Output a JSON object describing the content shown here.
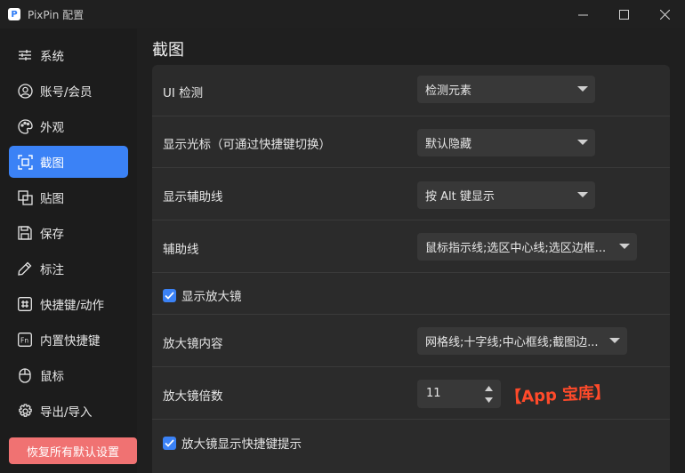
{
  "window": {
    "title": "PixPin 配置",
    "logo_letter": "P"
  },
  "sidebar": {
    "items": [
      {
        "label": "系统",
        "icon": "sliders-icon",
        "active": false
      },
      {
        "label": "账号/会员",
        "icon": "user-icon",
        "active": false
      },
      {
        "label": "外观",
        "icon": "palette-icon",
        "active": false
      },
      {
        "label": "截图",
        "icon": "screenshot-icon",
        "active": true
      },
      {
        "label": "贴图",
        "icon": "pin-image-icon",
        "active": false
      },
      {
        "label": "保存",
        "icon": "save-icon",
        "active": false
      },
      {
        "label": "标注",
        "icon": "pen-icon",
        "active": false
      },
      {
        "label": "快捷键/动作",
        "icon": "hash-icon",
        "active": false
      },
      {
        "label": "内置快捷键",
        "icon": "fn-key-icon",
        "active": false
      },
      {
        "label": "鼠标",
        "icon": "mouse-icon",
        "active": false
      },
      {
        "label": "导出/导入",
        "icon": "gear-icon",
        "active": false
      }
    ],
    "reset_label": "恢复所有默认设置"
  },
  "main": {
    "title": "截图",
    "settings": {
      "ui_detect": {
        "label": "UI 检测",
        "value": "检测元素"
      },
      "show_cursor": {
        "label": "显示光标（可通过快捷键切换）",
        "value": "默认隐藏"
      },
      "show_guides": {
        "label": "显示辅助线",
        "value": "按 Alt 键显示"
      },
      "guides": {
        "label": "辅助线",
        "value": "鼠标指示线;选区中心线;选区边框..."
      },
      "show_magnifier": {
        "label": "显示放大镜",
        "checked": true
      },
      "magnifier_content": {
        "label": "放大镜内容",
        "value": "网格线;十字线;中心框线;截图边..."
      },
      "magnifier_zoom": {
        "label": "放大镜倍数",
        "value": "11"
      },
      "magnifier_hint": {
        "label": "放大镜显示快捷键提示",
        "checked": true
      }
    }
  },
  "watermark": "【App 宝库】",
  "colors": {
    "accent": "#3b82f6",
    "reset_button": "#f07272",
    "watermark": "#ff4a2a"
  }
}
